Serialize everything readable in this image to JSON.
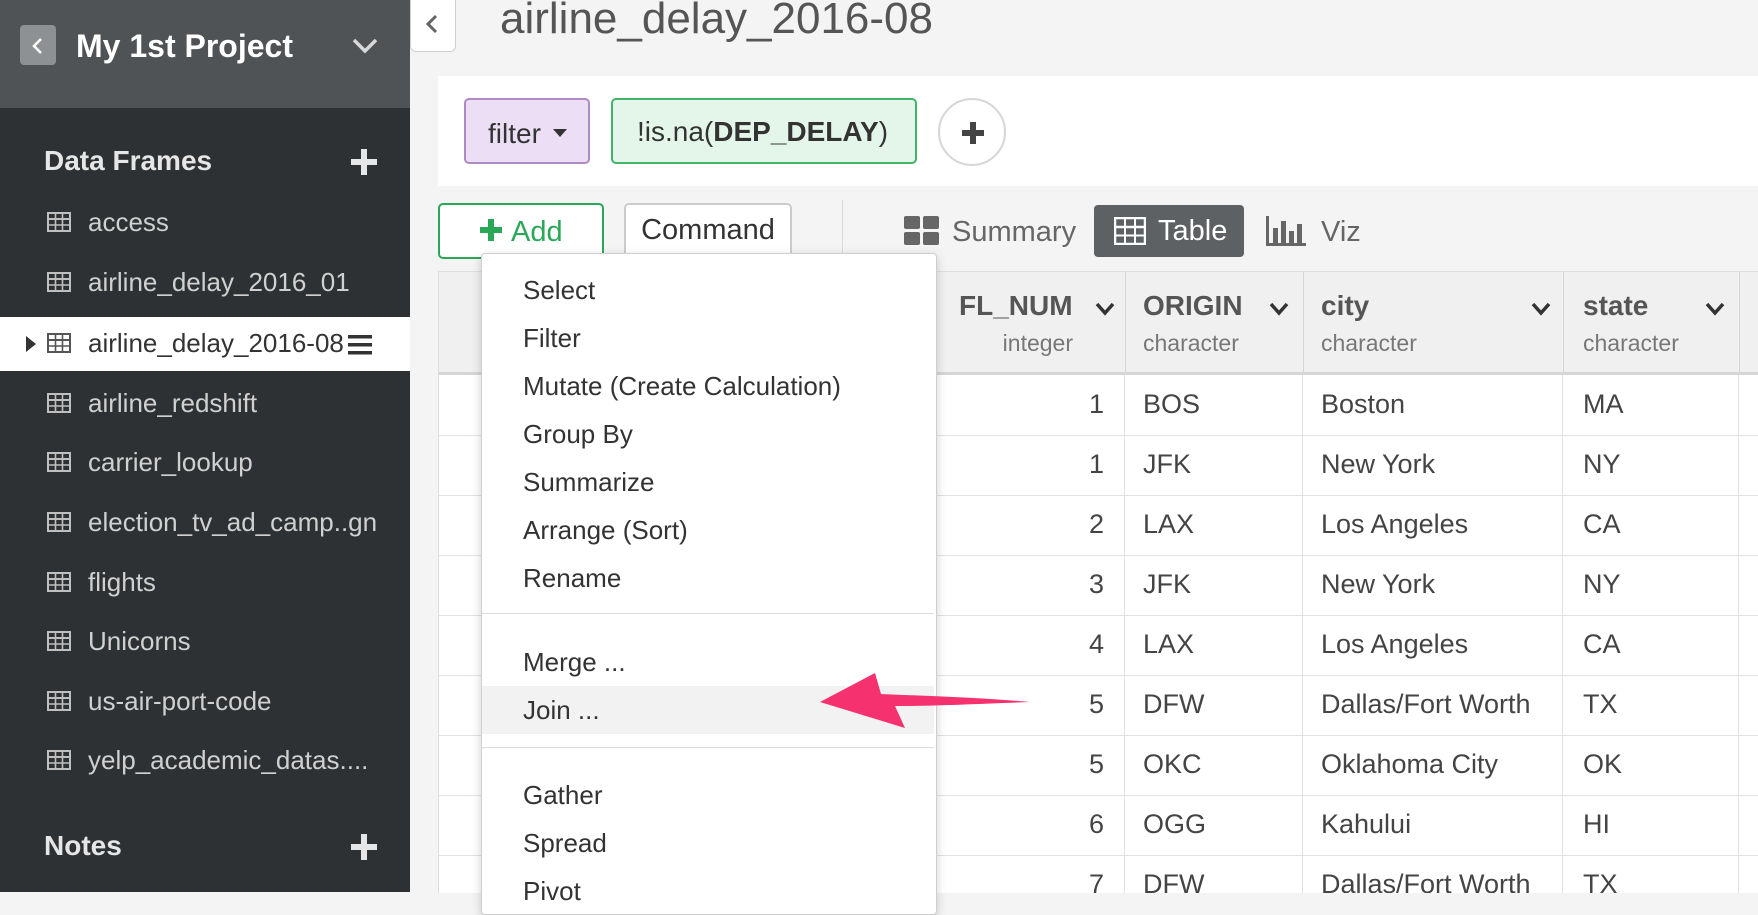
{
  "sidebar": {
    "project_title": "My 1st Project",
    "data_frames_title": "Data Frames",
    "data_frames": [
      {
        "label": "access"
      },
      {
        "label": "airline_delay_2016_01"
      },
      {
        "label": "airline_delay_2016-08",
        "active": true
      },
      {
        "label": "airline_redshift"
      },
      {
        "label": "carrier_lookup"
      },
      {
        "label": "election_tv_ad_camp..gn"
      },
      {
        "label": "flights"
      },
      {
        "label": "Unicorns"
      },
      {
        "label": "us-air-port-code"
      },
      {
        "label": "yelp_academic_datas...."
      }
    ],
    "notes_title": "Notes"
  },
  "main": {
    "title": "airline_delay_2016-08",
    "step": {
      "type": "filter",
      "expr_prefix": "!is.na(",
      "expr_column": "DEP_DELAY",
      "expr_suffix": ")"
    },
    "toolbar": {
      "add_label": "Add",
      "command_label": "Command",
      "views": {
        "summary": "Summary",
        "table": "Table",
        "viz": "Viz"
      },
      "active_view": "Table"
    },
    "table": {
      "columns": [
        {
          "name": "FL_NUM",
          "type": "integer"
        },
        {
          "name": "ORIGIN",
          "type": "character"
        },
        {
          "name": "city",
          "type": "character"
        },
        {
          "name": "state",
          "type": "character"
        }
      ],
      "rows": [
        [
          "1",
          "BOS",
          "Boston",
          "MA"
        ],
        [
          "1",
          "JFK",
          "New York",
          "NY"
        ],
        [
          "2",
          "LAX",
          "Los Angeles",
          "CA"
        ],
        [
          "3",
          "JFK",
          "New York",
          "NY"
        ],
        [
          "4",
          "LAX",
          "Los Angeles",
          "CA"
        ],
        [
          "5",
          "DFW",
          "Dallas/Fort Worth",
          "TX"
        ],
        [
          "5",
          "OKC",
          "Oklahoma City",
          "OK"
        ],
        [
          "6",
          "OGG",
          "Kahului",
          "HI"
        ],
        [
          "7",
          "DFW",
          "Dallas/Fort Worth",
          "TX"
        ]
      ]
    },
    "add_menu": {
      "group1": [
        "Select",
        "Filter",
        "Mutate (Create Calculation)",
        "Group By",
        "Summarize",
        "Arrange (Sort)",
        "Rename"
      ],
      "group2": [
        "Merge ...",
        "Join ..."
      ],
      "group3": [
        "Gather",
        "Spread",
        "Pivot"
      ],
      "highlighted": "Join ..."
    }
  },
  "colors": {
    "sidebar_bg": "#2e3133",
    "project_header_bg": "#4f5356",
    "add_green": "#2aa857",
    "filter_purple": "#b08ac6",
    "expr_green": "#42b36a",
    "annotation_arrow": "#f5316f"
  },
  "icons": {
    "back": "chevron-left-icon",
    "project_menu": "chevron-down-icon",
    "data_frame": "table-grid-icon",
    "add": "plus-icon",
    "df_menu": "hamburger-icon",
    "summary": "summary-tiles-icon",
    "table": "table-grid-icon",
    "viz": "bar-chart-icon"
  }
}
